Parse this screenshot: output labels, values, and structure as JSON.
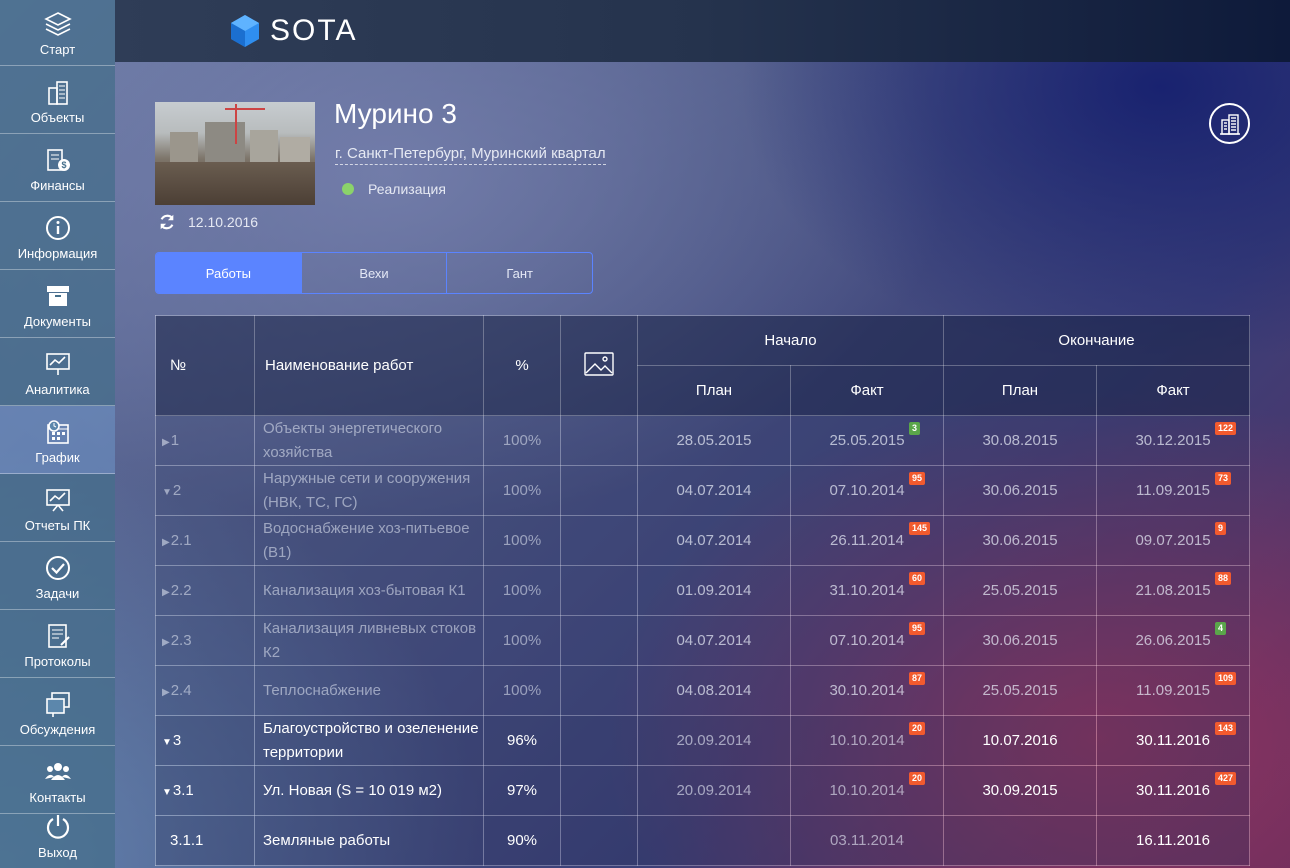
{
  "app": {
    "logo_text": "SOTA"
  },
  "sidebar": {
    "items": [
      {
        "label": "Старт",
        "icon": "layers-icon",
        "active": false
      },
      {
        "label": "Объекты",
        "icon": "buildings-icon",
        "active": false
      },
      {
        "label": "Финансы",
        "icon": "finance-icon",
        "active": false
      },
      {
        "label": "Информация",
        "icon": "info-icon",
        "active": false
      },
      {
        "label": "Документы",
        "icon": "archive-box-icon",
        "active": false
      },
      {
        "label": "Аналитика",
        "icon": "presentation-chart-icon",
        "active": false
      },
      {
        "label": "График",
        "icon": "calendar-clock-icon",
        "active": true
      },
      {
        "label": "Отчеты ПК",
        "icon": "report-board-icon",
        "active": false
      },
      {
        "label": "Задачи",
        "icon": "check-circle-icon",
        "active": false
      },
      {
        "label": "Протоколы",
        "icon": "protocol-doc-icon",
        "active": false
      },
      {
        "label": "Обсуждения",
        "icon": "chat-windows-icon",
        "active": false
      },
      {
        "label": "Контакты",
        "icon": "contacts-group-icon",
        "active": false
      },
      {
        "label": "Выход",
        "icon": "power-icon",
        "active": false
      }
    ]
  },
  "project": {
    "title": "Мурино 3",
    "address": "г. Санкт-Петербург, Муринский квартал",
    "status": "Реализация",
    "status_color": "#8bd36a",
    "updated": "12.10.2016"
  },
  "tabs": [
    {
      "label": "Работы",
      "active": true
    },
    {
      "label": "Вехи",
      "active": false
    },
    {
      "label": "Гант",
      "active": false
    }
  ],
  "table": {
    "headers": {
      "no": "№",
      "name": "Наименование работ",
      "percent": "%",
      "start": "Начало",
      "end": "Окончание",
      "plan": "План",
      "fact": "Факт"
    },
    "rows": [
      {
        "no": "1",
        "marker": "▶",
        "name": "Объекты энергетического хозяйства",
        "pct": "100%",
        "sp": "28.05.2015",
        "sf": "25.05.2015",
        "sf_badge": "3",
        "sf_badge_color": "green",
        "ep": "30.08.2015",
        "ef": "30.12.2015",
        "ef_badge": "122",
        "ef_badge_color": "red",
        "style": "dim"
      },
      {
        "no": "2",
        "marker": "▼",
        "name": "Наружные сети и сооружения (НВК, ТС, ГС)",
        "pct": "100%",
        "sp": "04.07.2014",
        "sf": "07.10.2014",
        "sf_badge": "95",
        "sf_badge_color": "red",
        "ep": "30.06.2015",
        "ef": "11.09.2015",
        "ef_badge": "73",
        "ef_badge_color": "red",
        "style": "dim"
      },
      {
        "no": "2.1",
        "marker": "▶",
        "name": "Водоснабжение хоз-питьевое (В1)",
        "pct": "100%",
        "sp": "04.07.2014",
        "sf": "26.11.2014",
        "sf_badge": "145",
        "sf_badge_color": "red",
        "ep": "30.06.2015",
        "ef": "09.07.2015",
        "ef_badge": "9",
        "ef_badge_color": "red",
        "style": "dim"
      },
      {
        "no": "2.2",
        "marker": "▶",
        "name": "Канализация хоз-бытовая К1",
        "pct": "100%",
        "sp": "01.09.2014",
        "sf": "31.10.2014",
        "sf_badge": "60",
        "sf_badge_color": "red",
        "ep": "25.05.2015",
        "ef": "21.08.2015",
        "ef_badge": "88",
        "ef_badge_color": "red",
        "style": "dim"
      },
      {
        "no": "2.3",
        "marker": "▶",
        "name": "Канализация ливневых стоков К2",
        "pct": "100%",
        "sp": "04.07.2014",
        "sf": "07.10.2014",
        "sf_badge": "95",
        "sf_badge_color": "red",
        "ep": "30.06.2015",
        "ef": "26.06.2015",
        "ef_badge": "4",
        "ef_badge_color": "green",
        "style": "dim"
      },
      {
        "no": "2.4",
        "marker": "▶",
        "name": "Теплоснабжение",
        "pct": "100%",
        "sp": "04.08.2014",
        "sf": "30.10.2014",
        "sf_badge": "87",
        "sf_badge_color": "red",
        "ep": "25.05.2015",
        "ef": "11.09.2015",
        "ef_badge": "109",
        "ef_badge_color": "red",
        "style": "dim"
      },
      {
        "no": "3",
        "marker": "▼",
        "name": "Благоустройство и озеленение территории",
        "pct": "96%",
        "sp": "20.09.2014",
        "sf": "10.10.2014",
        "sf_badge": "20",
        "sf_badge_color": "red",
        "ep": "10.07.2016",
        "ef": "30.11.2016",
        "ef_badge": "143",
        "ef_badge_color": "red",
        "style": "bright"
      },
      {
        "no": "3.1",
        "marker": "▼",
        "name": "Ул. Новая (S = 10 019 м2)",
        "pct": "97%",
        "sp": "20.09.2014",
        "sf": "10.10.2014",
        "sf_badge": "20",
        "sf_badge_color": "red",
        "ep": "30.09.2015",
        "ef": "30.11.2016",
        "ef_badge": "427",
        "ef_badge_color": "red",
        "style": "bright"
      },
      {
        "no": "3.1.1",
        "marker": "",
        "name": "Земляные работы",
        "pct": "90%",
        "sp": "",
        "sf": "03.11.2014",
        "sf_badge": "",
        "sf_badge_color": "",
        "ep": "",
        "ef": "16.11.2016",
        "ef_badge": "",
        "ef_badge_color": "",
        "style": "bright"
      }
    ]
  }
}
